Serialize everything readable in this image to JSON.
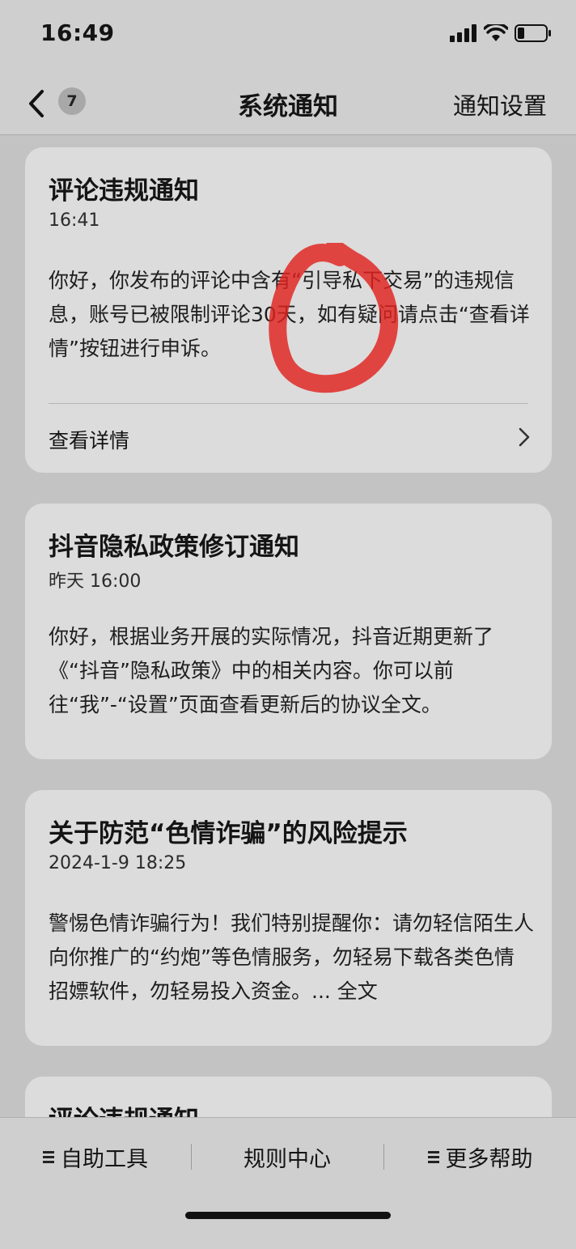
{
  "status_bar": {
    "time": "16:49"
  },
  "nav": {
    "unread_count": "7",
    "title": "系统通知",
    "settings_label": "通知设置"
  },
  "notifications": [
    {
      "title": "评论违规通知",
      "time": "16:41",
      "body": "你好，你发布的评论中含有“引导私下交易”的违规信息，账号已被限制评论30天，如有疑问请点击“查看详情”按钮进行申诉。",
      "action_label": "查看详情"
    },
    {
      "title": "抖音隐私政策修订通知",
      "time": "昨天 16:00",
      "body": "你好，根据业务开展的实际情况，抖音近期更新了《“抖音”隐私政策》中的相关内容。你可以前往“我”-“设置”页面查看更新后的协议全文。"
    },
    {
      "title": "关于防范“色情诈骗”的风险提示",
      "time": "2024-1-9 18:25",
      "body": "警惕色情诈骗行为！我们特别提醒你：请勿轻信陌生人向你推广的“约炮”等色情服务，勿轻易下载各类色情招嫖软件，勿轻易投入资金。... 全文"
    },
    {
      "title": "评论违规通知"
    }
  ],
  "bottom_bar": {
    "tabs": [
      "自助工具",
      "规则中心",
      "更多帮助"
    ]
  },
  "colors": {
    "page_background": "#c3c3c3",
    "card_background": "#dcdcdc",
    "annotation_red": "#e0221e"
  },
  "icons": [
    "back-arrow-icon",
    "signal-icon",
    "wifi-icon",
    "battery-icon",
    "chevron-right-icon",
    "menu-icon"
  ]
}
